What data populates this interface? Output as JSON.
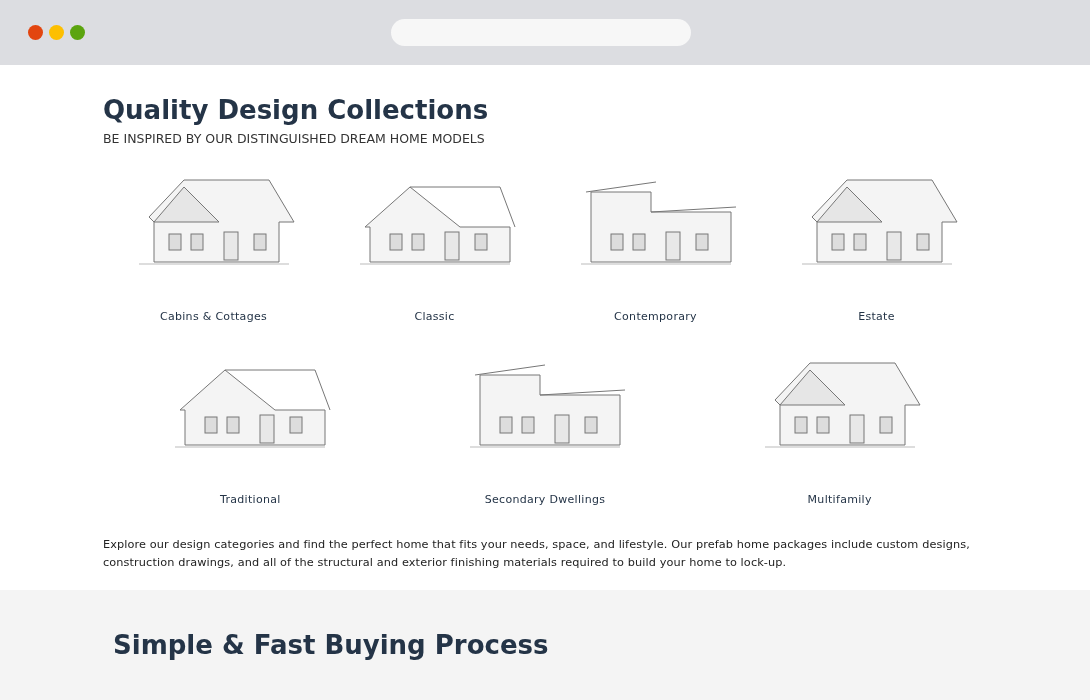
{
  "title": "Quality Design Collections",
  "subtitle": "BE INSPIRED BY OUR DISTINGUISHED DREAM HOME MODELS",
  "collection_rows": [
    {
      "items": [
        {
          "label": "Cabins & Cottages"
        },
        {
          "label": "Classic"
        },
        {
          "label": "Contemporary"
        },
        {
          "label": "Estate"
        }
      ]
    },
    {
      "items": [
        {
          "label": "Traditional"
        },
        {
          "label": "Secondary Dwellings"
        },
        {
          "label": "Multifamily"
        }
      ]
    }
  ],
  "description": "Explore our design categories and find the perfect home that fits your needs, space, and lifestyle. Our prefab home packages include custom designs, construction drawings, and all of the structural and exterior finishing materials required to build your home to lock-up.",
  "next_section": {
    "title": "Simple & Fast Buying Process"
  }
}
